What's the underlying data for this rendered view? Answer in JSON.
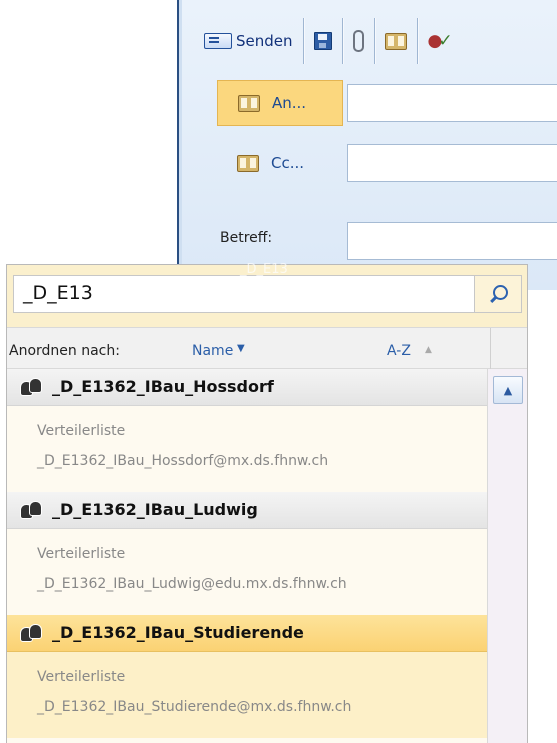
{
  "compose": {
    "toolbar": {
      "send_label": "Senden",
      "icons": [
        "send-icon",
        "save-icon",
        "attach-icon",
        "address-book-icon",
        "check-names-icon"
      ]
    },
    "to_label": "An...",
    "cc_label": "Cc...",
    "subject_label": "Betreff:"
  },
  "ghost_text": "_D_E13",
  "search": {
    "value": "_D_E13",
    "icon": "search-icon"
  },
  "sort": {
    "label": "Anordnen nach:",
    "value": "Name",
    "order": "A-Z"
  },
  "results": [
    {
      "name": "_D_E1362_IBau_Hossdorf",
      "type": "Verteilerliste",
      "email": "_D_E1362_IBau_Hossdorf@mx.ds.fhnw.ch"
    },
    {
      "name": "_D_E1362_IBau_Ludwig",
      "type": "Verteilerliste",
      "email": "_D_E1362_IBau_Ludwig@edu.mx.ds.fhnw.ch"
    },
    {
      "name": "_D_E1362_IBau_Studierende",
      "type": "Verteilerliste",
      "email": "_D_E1362_IBau_Studierende@mx.ds.fhnw.ch"
    }
  ],
  "colors": {
    "selection": "#fbd273",
    "link": "#2b5ea8",
    "window_border": "#2a4f82"
  }
}
